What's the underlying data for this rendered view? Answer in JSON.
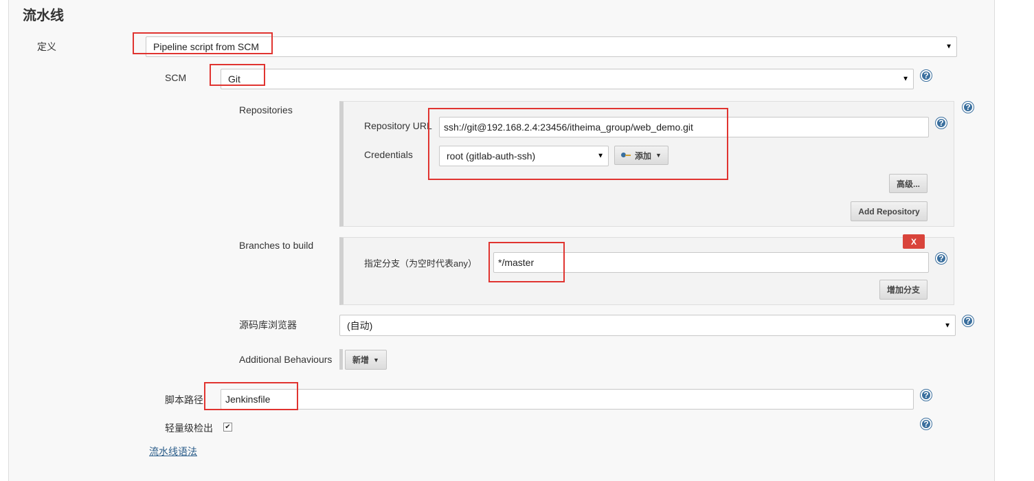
{
  "section": {
    "title": "流水线"
  },
  "definition": {
    "label": "定义",
    "value": "Pipeline script from SCM"
  },
  "scm": {
    "label": "SCM",
    "value": "Git"
  },
  "repositories": {
    "label": "Repositories",
    "url_label": "Repository URL",
    "url_value": "ssh://git@192.168.2.4:23456/itheima_group/web_demo.git",
    "credentials_label": "Credentials",
    "credentials_value": "root (gitlab-auth-ssh)",
    "add_button": "添加",
    "advanced_button": "高级...",
    "add_repo_button": "Add Repository"
  },
  "branches": {
    "label": "Branches to build",
    "spec_label": "指定分支（为空时代表any）",
    "spec_value": "*/master",
    "delete_button": "X",
    "add_branch_button": "增加分支"
  },
  "browser": {
    "label": "源码库浏览器",
    "value": "(自动)"
  },
  "behaviours": {
    "label": "Additional Behaviours",
    "add_button": "新增"
  },
  "script_path": {
    "label": "脚本路径",
    "value": "Jenkinsfile"
  },
  "lightweight": {
    "label": "轻量级检出",
    "checked_mark": "✔"
  },
  "syntax_link": "流水线语法",
  "help_glyph": "?"
}
